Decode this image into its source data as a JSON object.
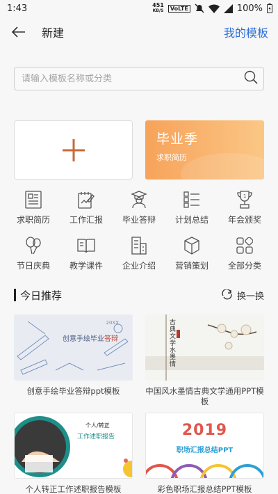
{
  "status": {
    "time": "1:43",
    "speed_value": "451",
    "speed_unit": "KB/S",
    "volte": "VoLTE",
    "battery": "100%"
  },
  "appbar": {
    "title": "新建",
    "my_templates": "我的模板"
  },
  "search": {
    "placeholder": "请输入模板名称或分类"
  },
  "banner": {
    "title": "毕业季",
    "subtitle": "求职简历"
  },
  "categories": [
    {
      "label": "求职简历",
      "icon": "resume-icon"
    },
    {
      "label": "工作汇报",
      "icon": "report-icon"
    },
    {
      "label": "毕业答辩",
      "icon": "graduate-icon"
    },
    {
      "label": "计划总结",
      "icon": "checklist-icon"
    },
    {
      "label": "年会颁奖",
      "icon": "trophy-icon"
    },
    {
      "label": "节日庆典",
      "icon": "balloon-icon"
    },
    {
      "label": "教学课件",
      "icon": "book-icon"
    },
    {
      "label": "企业介绍",
      "icon": "building-icon"
    },
    {
      "label": "营销策划",
      "icon": "box-icon"
    },
    {
      "label": "全部分类",
      "icon": "grid-icon"
    }
  ],
  "section": {
    "title": "今日推荐",
    "refresh": "换一换"
  },
  "templates": [
    {
      "caption": "创意手绘毕业答辩ppt模板",
      "thumb_title": "创意手绘毕业",
      "thumb_title_accent": "答辩",
      "thumb_year": "20XX"
    },
    {
      "caption": "中国风水墨情古典文学通用PPT模板",
      "thumb_title": "古典文学水墨情"
    },
    {
      "caption": "个人转正工作述职报告模板",
      "thumb_name": "个人/转正",
      "thumb_title": "工作述职报告"
    },
    {
      "caption": "彩色职场汇报总结PPT模板",
      "thumb_year": "2019",
      "thumb_title": "职场汇报总结PPT"
    }
  ]
}
